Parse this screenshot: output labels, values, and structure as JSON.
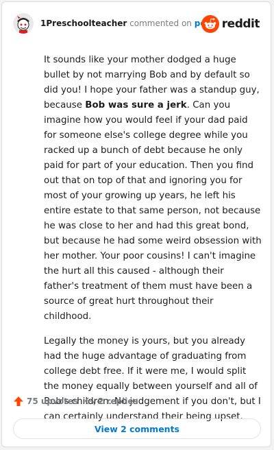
{
  "header": {
    "username": "1Preschoolteacher",
    "action_text": "commented on",
    "post_link": "post",
    "logo_text": "reddit"
  },
  "comment": {
    "p1_before_bold": "It sounds like your mother dodged a huge bullet by not marrying Bob and by default so did you! I hope your father was a standup guy, because ",
    "p1_bold": "Bob was sure a jerk",
    "p1_after_bold": ". Can you imagine how you would feel if your dad paid for someone else's college degree while you racked up a bunch of debt because he only paid for part of your education. Then you find out that on top of that and ignoring you for most of your growing up years, he left his entire estate to that same person, not because he was close to her and had this great bond, but because he had some weird obsession with her mother. Your poor cousins! I can't imagine the hurt all this caused - although their father's treatment of them must have been a source of great hurt throughout their childhood.",
    "p2": "Legally the money is yours, but you already had the huge advantage of graduating from college debt free. If it were me, I would split the money equally between yourself and all of Bob's children. No judgement if you don't, but I can certainly understand their being upset."
  },
  "footer": {
    "upvotes": "75 upvotes",
    "replies": "2 replies",
    "view_comments": "View 2 comments"
  },
  "colors": {
    "reddit_orange": "#ff4500",
    "link_blue": "#0079d3"
  },
  "icons": [
    "avatar-icon",
    "reddit-logo-icon",
    "upvote-arrow-icon",
    "reply-icon"
  ]
}
